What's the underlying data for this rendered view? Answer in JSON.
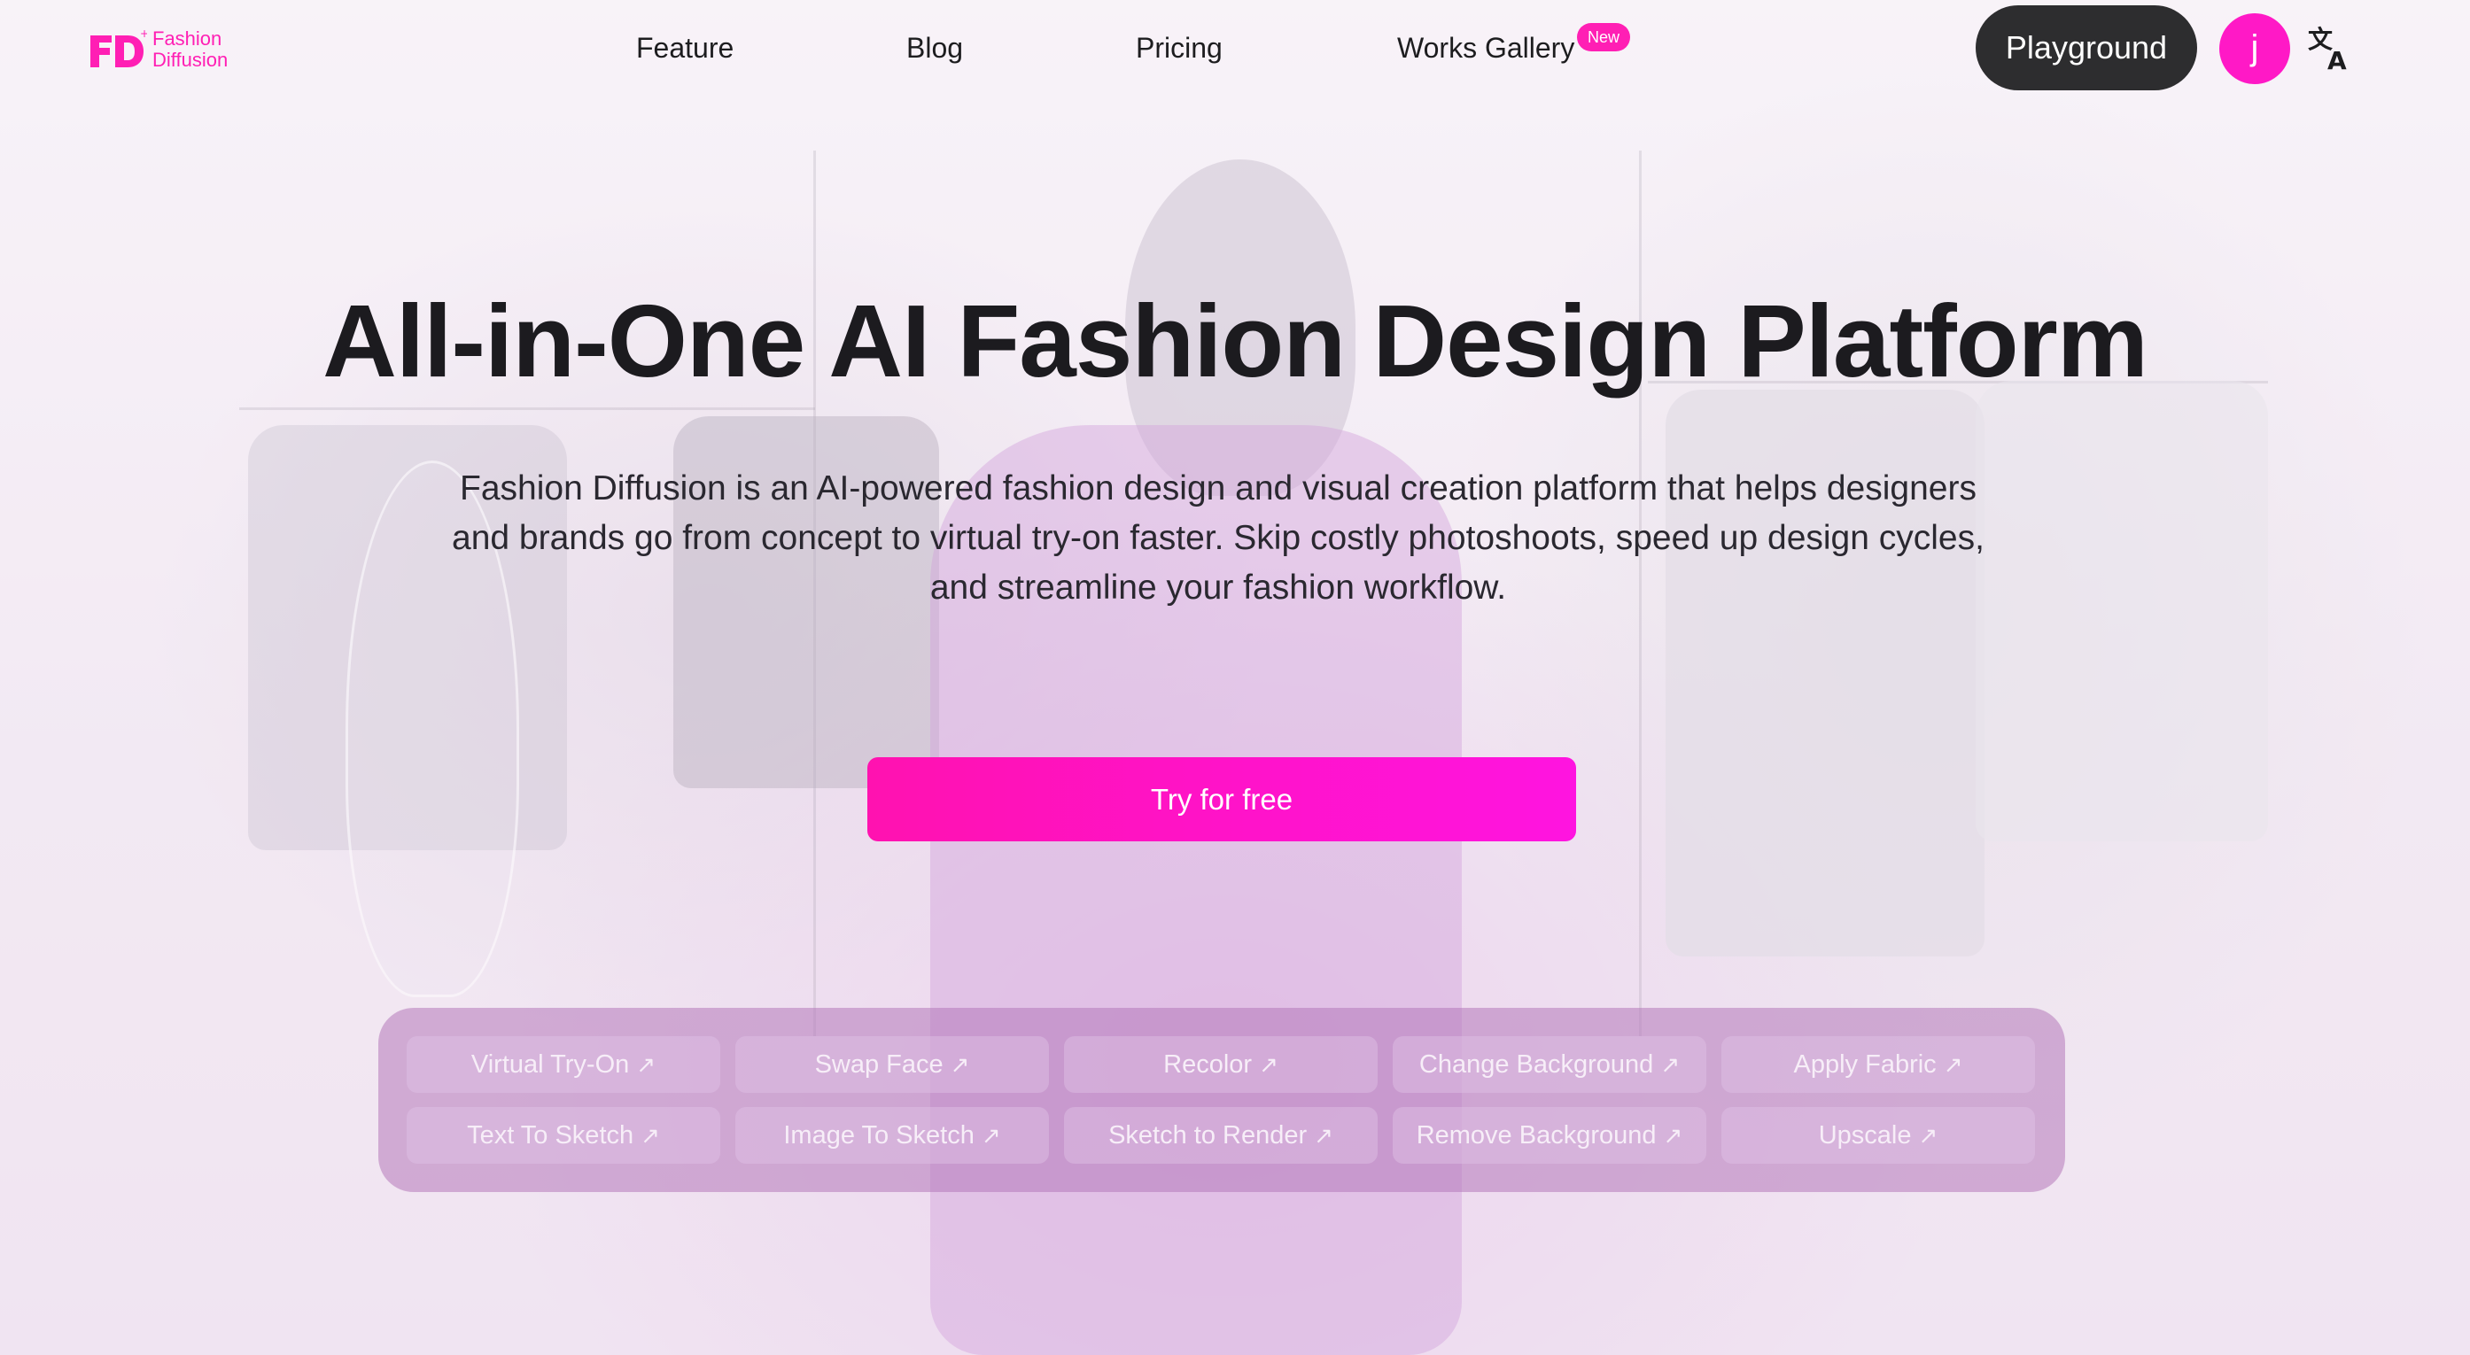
{
  "brand": {
    "logo_mark": "FD",
    "name_line1": "Fashion",
    "name_line2": "Diffusion",
    "accent_color": "#ff1fb4"
  },
  "nav": {
    "links": [
      {
        "label": "Feature"
      },
      {
        "label": "Blog"
      },
      {
        "label": "Pricing"
      },
      {
        "label": "Works Gallery"
      }
    ],
    "new_badge": "New",
    "playground_label": "Playground",
    "avatar_initial": "j",
    "language_icon": "translate-icon"
  },
  "hero": {
    "title": "All-in-One AI Fashion Design Platform",
    "description": "Fashion Diffusion is an AI-powered fashion design and visual creation platform that helps designers and brands go from concept to virtual try-on faster. Skip costly photoshoots, speed up design cycles, and streamline your fashion workflow.",
    "cta_label": "Try for free",
    "cta_color": "#ff12b0"
  },
  "tools": {
    "arrow_icon": "arrow-up-right-icon",
    "arrow_glyph": "↗",
    "items": [
      {
        "label": "Virtual Try-On"
      },
      {
        "label": "Swap Face"
      },
      {
        "label": "Recolor"
      },
      {
        "label": "Change Background"
      },
      {
        "label": "Apply Fabric"
      },
      {
        "label": "Text To Sketch"
      },
      {
        "label": "Image To Sketch"
      },
      {
        "label": "Sketch to Render"
      },
      {
        "label": "Remove Background"
      },
      {
        "label": "Upscale"
      }
    ]
  }
}
